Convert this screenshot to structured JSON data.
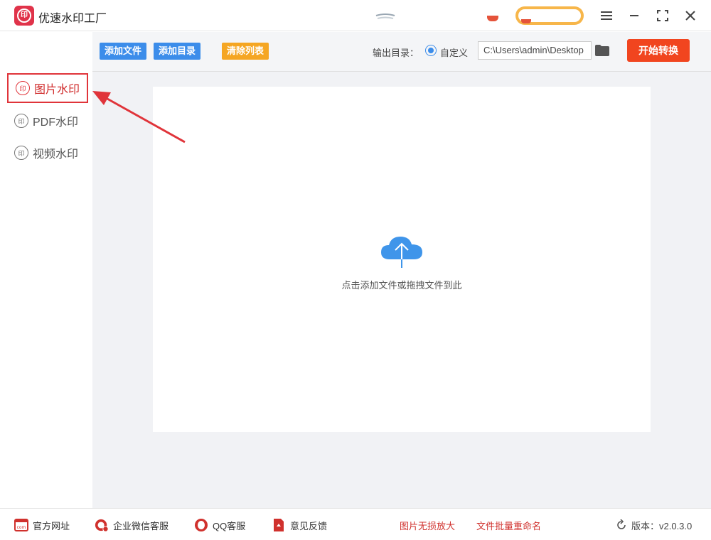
{
  "app": {
    "title": "优速水印工厂",
    "logo_text": "印"
  },
  "sidebar": {
    "items": [
      {
        "label": "图片水印",
        "icon": "watermark-icon",
        "active": true
      },
      {
        "label": "PDF水印",
        "icon": "watermark-icon",
        "active": false
      },
      {
        "label": "视频水印",
        "icon": "watermark-icon",
        "active": false
      }
    ]
  },
  "toolbar": {
    "add_file": "添加文件",
    "add_folder": "添加目录",
    "clear_list": "清除列表",
    "output_label": "输出目录：",
    "custom_label": "自定义",
    "output_path": "C:\\Users\\admin\\Desktop",
    "start": "开始转换"
  },
  "dropzone": {
    "hint": "点击添加文件或拖拽文件到此"
  },
  "footer": {
    "website": "官方网址",
    "wechat": "企业微信客服",
    "qq": "QQ客服",
    "feedback": "意见反馈",
    "link1": "图片无损放大",
    "link2": "文件批量重命名",
    "version": "版本：v2.0.3.0"
  },
  "colors": {
    "accent_red": "#f1451f",
    "blue": "#3c8dea",
    "orange": "#f5a623",
    "annotation": "#e0343a"
  }
}
